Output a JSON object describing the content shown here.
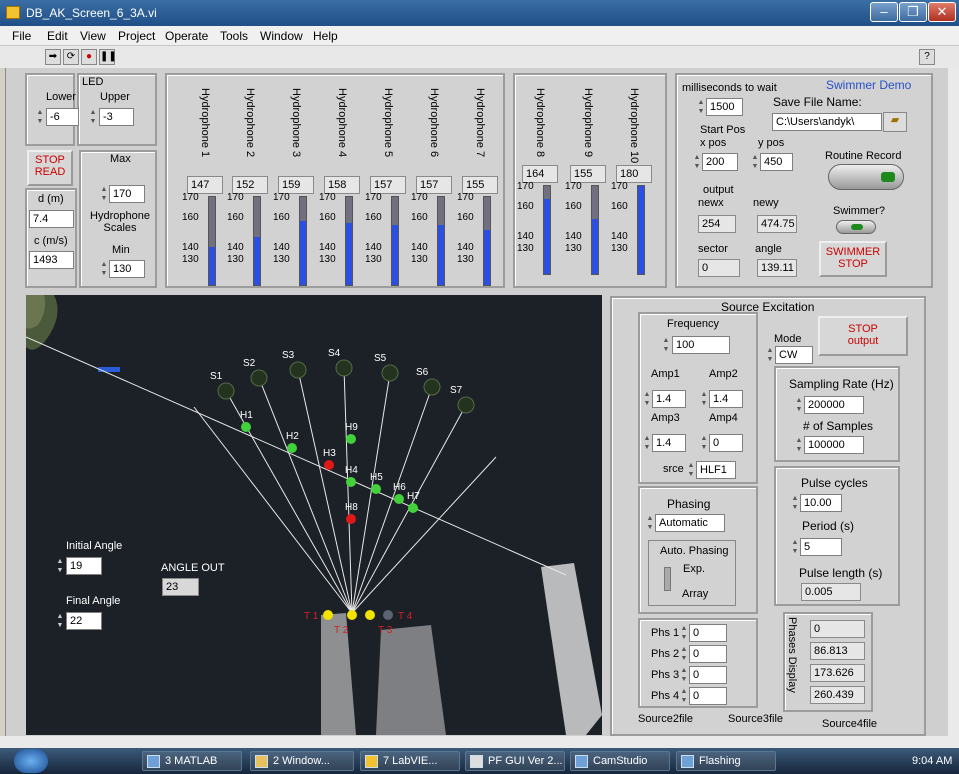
{
  "window": {
    "title": "DB_AK_Screen_6_3A.vi",
    "minimize": "–",
    "maximize": "❐",
    "close": "✕"
  },
  "menu": [
    "File",
    "Edit",
    "View",
    "Project",
    "Operate",
    "Tools",
    "Window",
    "Help"
  ],
  "toolbar": {
    "run": "➡",
    "run_cont": "⟳",
    "abort": "●",
    "pause": "❚❚",
    "help": "?"
  },
  "led": {
    "title": "LED",
    "lower_label": "Lower",
    "upper_label": "Upper",
    "lower": "-6",
    "upper": "-3"
  },
  "stop_read": "STOP\nREAD",
  "d_label": "d (m)",
  "d": "7.4",
  "c_label": "c (m/s)",
  "c": "1493",
  "scales": {
    "max_label": "Max",
    "max": "170",
    "title": "Hydrophone\nScales",
    "min_label": "Min",
    "min": "130"
  },
  "hydrophones": [
    {
      "name": "Hydrophone 1",
      "value": "147",
      "level": 0.43
    },
    {
      "name": "Hydrophone 2",
      "value": "152",
      "level": 0.55
    },
    {
      "name": "Hydrophone 3",
      "value": "159",
      "level": 0.73
    },
    {
      "name": "Hydrophone 4",
      "value": "158",
      "level": 0.7
    },
    {
      "name": "Hydrophone 5",
      "value": "157",
      "level": 0.68
    },
    {
      "name": "Hydrophone 6",
      "value": "157",
      "level": 0.68
    },
    {
      "name": "Hydrophone 7",
      "value": "155",
      "level": 0.63
    },
    {
      "name": "Hydrophone 8",
      "value": "164",
      "level": 0.85
    },
    {
      "name": "Hydrophone 9",
      "value": "155",
      "level": 0.63
    },
    {
      "name": "Hydrophone 10",
      "value": "180",
      "level": 1
    }
  ],
  "scale_ticks": [
    "170",
    "160",
    "140",
    "130"
  ],
  "swimmer": {
    "demo_label": "Swimmer Demo",
    "ms_label": "milliseconds to wait",
    "ms": "1500",
    "save_label": "Save File Name:",
    "save_path": "C:\\Users\\andyk\\",
    "start_pos": "Start Pos",
    "xpos_label": "x pos",
    "xpos": "200",
    "ypos_label": "y pos",
    "ypos": "450",
    "routine_label": "Routine Record",
    "output": "output",
    "newx_label": "newx",
    "newx": "254",
    "newy_label": "newy",
    "newy": "474.75",
    "swimmer_q": "Swimmer?",
    "sector_label": "sector",
    "sector": "0",
    "angle_label": "angle",
    "angle": "139.11",
    "stop": "SWIMMER\nSTOP"
  },
  "source": {
    "title": "Source Excitation",
    "freq_label": "Frequency",
    "freq": "100",
    "mode_label": "Mode",
    "mode": "CW",
    "stop_output": "STOP\noutput",
    "amp1_label": "Amp1",
    "amp1": "1.4",
    "amp2_label": "Amp2",
    "amp2": "1.4",
    "amp3_label": "Amp3",
    "amp3": "1.4",
    "amp4_label": "Amp4",
    "amp4": "0",
    "srce_label": "srce",
    "srce": "HLF1",
    "sr_label": "Sampling Rate (Hz)",
    "sr": "200000",
    "ns_label": "# of Samples",
    "ns": "100000",
    "pc_label": "Pulse cycles",
    "pc": "10.00",
    "period_label": "Period (s)",
    "period": "5",
    "pl_label": "Pulse length (s)",
    "pl": "0.005",
    "phasing_label": "Phasing",
    "phasing": "Automatic",
    "auto_label": "Auto. Phasing",
    "exp": "Exp.",
    "array": "Array",
    "phs_labels": [
      "Phs 1",
      "Phs 2",
      "Phs 3",
      "Phs 4"
    ],
    "phs": [
      "0",
      "0",
      "0",
      "0"
    ],
    "phases_display": "Phases Display",
    "phases": [
      "0",
      "86.813",
      "173.626",
      "260.439"
    ],
    "file2": "Source2file",
    "file3": "Source3file",
    "file4": "Source4file"
  },
  "map": {
    "initial_label": "Initial Angle",
    "initial": "19",
    "final_label": "Final Angle",
    "final": "22",
    "angle_out_label": "ANGLE OUT",
    "angle_out": "23",
    "sensors": [
      "S1",
      "S2",
      "S3",
      "S4",
      "S5",
      "S6",
      "S7"
    ],
    "hydros": [
      "H1",
      "H2",
      "H3",
      "H4",
      "H5",
      "H6",
      "H7",
      "H8",
      "H9"
    ],
    "transducers": [
      "T 1",
      "T 2",
      "T 3",
      "T 4"
    ]
  },
  "taskbar": {
    "items": [
      "3 MATLAB",
      "2 Window...",
      "7 LabVIE...",
      "PF GUI Ver 2...",
      "CamStudio",
      "Flashing"
    ],
    "time": "9:04 AM"
  }
}
